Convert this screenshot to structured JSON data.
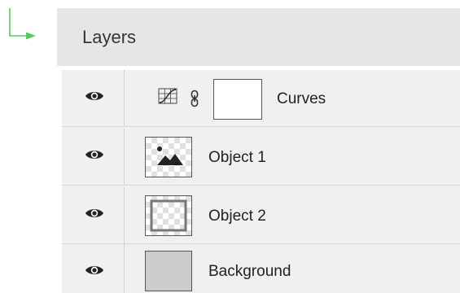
{
  "panel": {
    "title": "Layers"
  },
  "layers": [
    {
      "name": "Curves",
      "type": "adjustment",
      "visible": true,
      "icon": "curves-adjustment-icon"
    },
    {
      "name": "Object 1",
      "type": "image",
      "visible": true,
      "icon": "image-thumbnail-icon"
    },
    {
      "name": "Object 2",
      "type": "frame",
      "visible": true,
      "icon": "frame-thumbnail-icon"
    },
    {
      "name": "Background",
      "type": "fill",
      "visible": true,
      "icon": "solid-fill-thumbnail"
    }
  ],
  "colors": {
    "pointer_green": "#5cc85c",
    "header_bg": "#e6e6e6",
    "list_bg": "#f0f0f0",
    "background_fill": "#cccccc"
  }
}
